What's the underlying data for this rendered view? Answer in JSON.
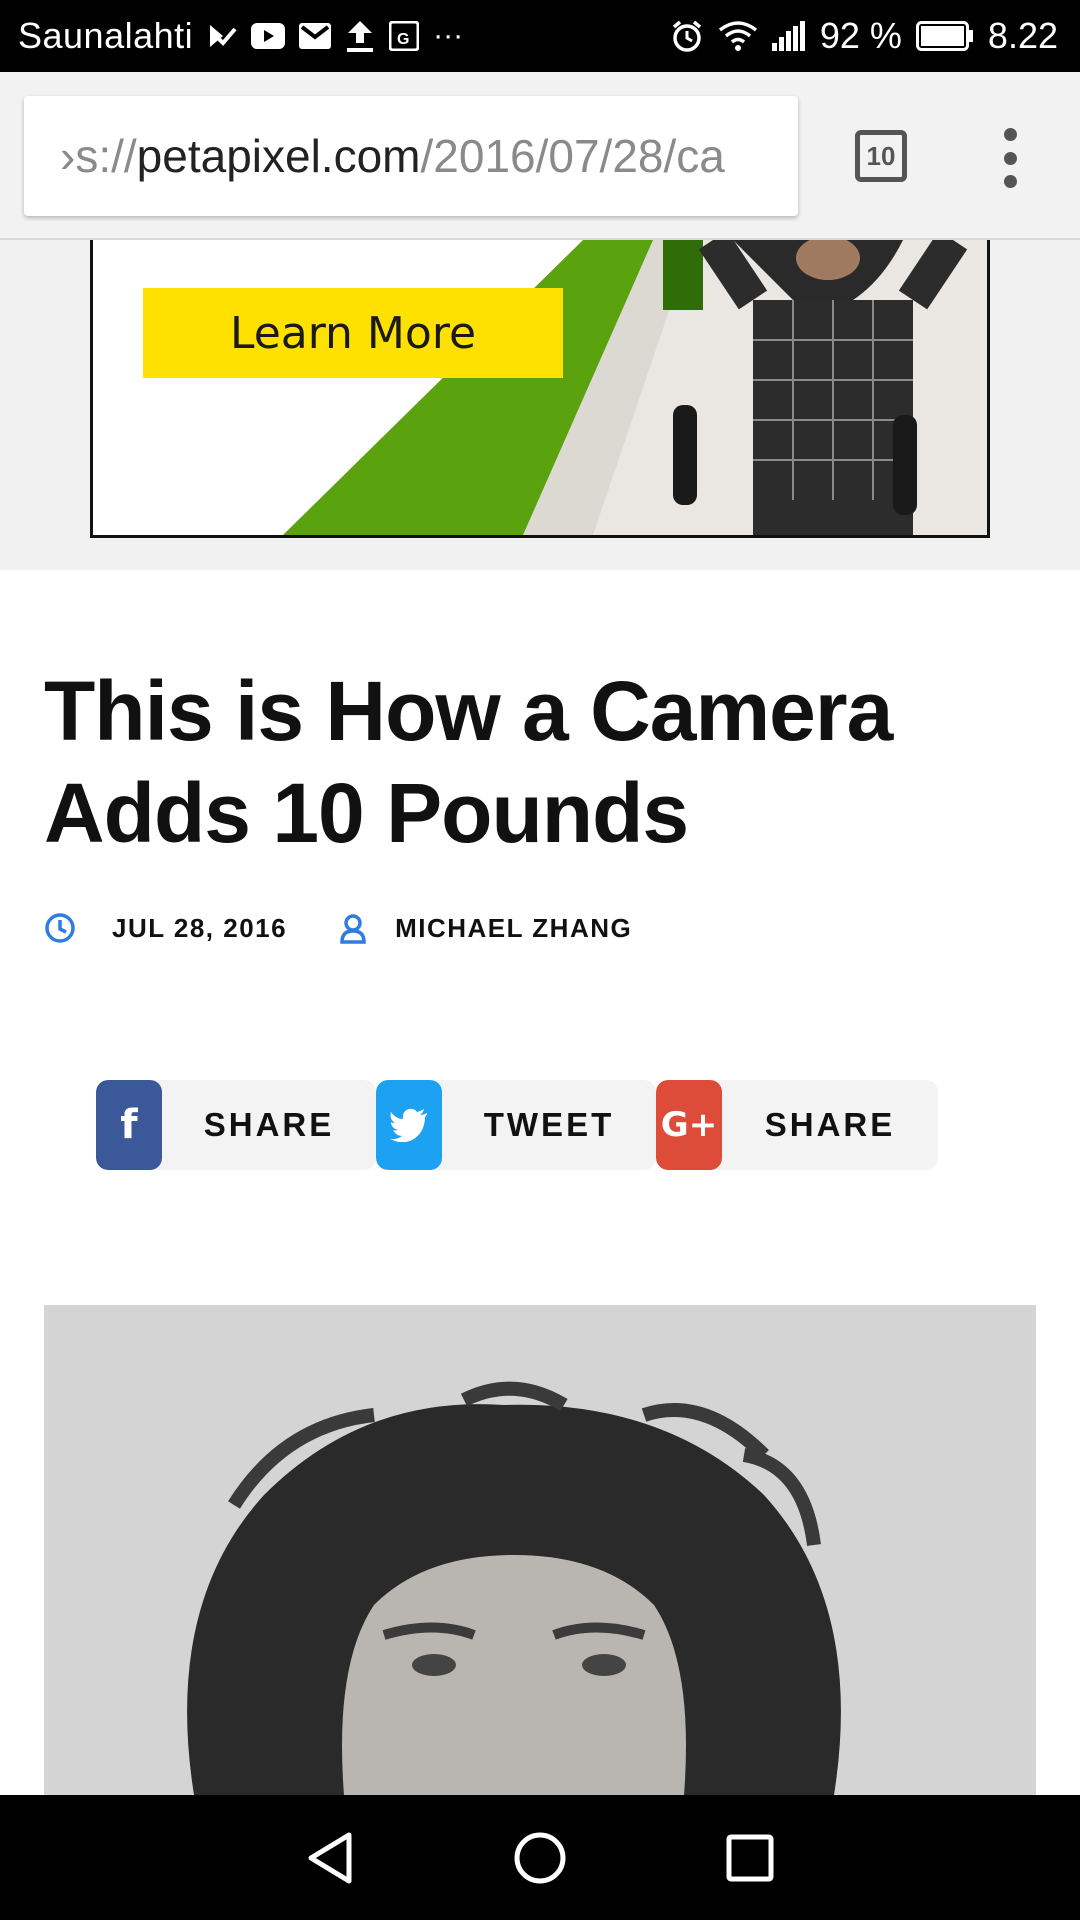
{
  "status_bar": {
    "carrier": "Saunalahti",
    "more_indicator": "···",
    "battery_percent": "92 %",
    "time": "8.22",
    "icons": [
      "check-flag-icon",
      "youtube-icon",
      "gmail-icon",
      "upload-icon",
      "maps-icon",
      "alarm-icon",
      "wifi-icon",
      "signal-icon",
      "battery-icon"
    ]
  },
  "browser": {
    "url_scheme_fragment": "›s://",
    "url_domain": "petapixel.com",
    "url_path": "/2016/07/28/ca",
    "tab_count": "10"
  },
  "ad": {
    "cta_label": "Learn More",
    "colors": {
      "cta": "#ffe100",
      "stripe": "#5aa30f"
    }
  },
  "article": {
    "title": "This is How a Camera Adds 10 Pounds",
    "date": "JUL 28, 2016",
    "author": "MICHAEL ZHANG",
    "meta_icon_color": "#2f7de1"
  },
  "share": {
    "facebook_label": "SHARE",
    "twitter_label": "TWEET",
    "googleplus_label": "SHARE",
    "facebook_glyph": "f",
    "googleplus_glyph": "G+",
    "colors": {
      "facebook": "#3b5998",
      "twitter": "#1da1f2",
      "googleplus": "#dd4b39"
    }
  },
  "nav": {
    "icons": [
      "back-icon",
      "home-icon",
      "recents-icon"
    ]
  }
}
